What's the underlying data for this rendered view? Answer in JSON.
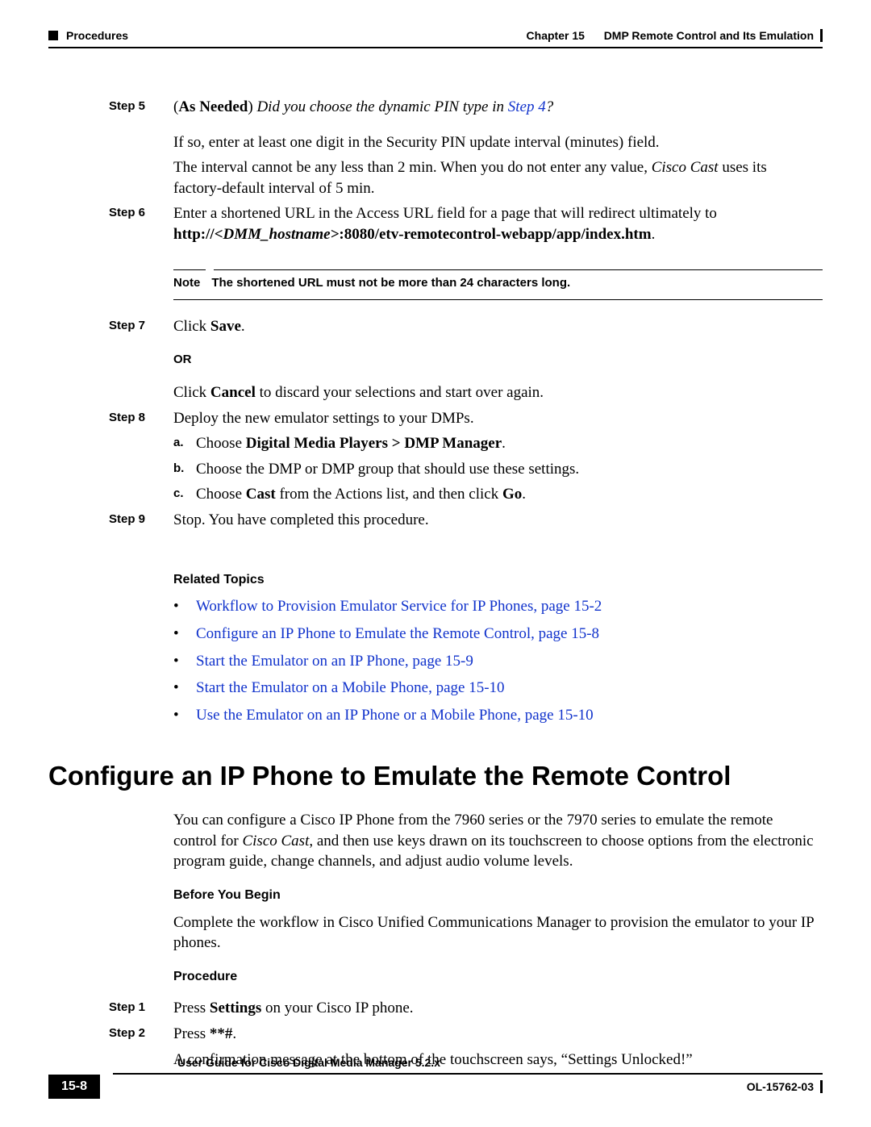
{
  "header": {
    "section": "Procedures",
    "chapter_label": "Chapter 15",
    "chapter_title": "DMP Remote Control and Its Emulation"
  },
  "steps": {
    "s5_label": "Step 5",
    "s5_prefix": "(",
    "s5_bold": "As Needed",
    "s5_suffix": ")",
    "s5_italic": " Did you choose the dynamic PIN type in ",
    "s5_link": "Step 4",
    "s5_qmark": "?",
    "s5_p1": "If so, enter at least one digit in the Security PIN update interval (minutes) field.",
    "s5_p2a": "The interval cannot be any less than 2 min. When you do not enter any value, ",
    "s5_p2i": "Cisco Cast",
    "s5_p2b": " uses its factory-default interval of 5 min.",
    "s6_label": "Step 6",
    "s6_a": "Enter a shortened URL in the Access URL field for a page that will redirect ultimately to ",
    "s6_b1": "http://",
    "s6_bi": "<DMM_hostname>",
    "s6_b2": ":8080/etv-remotecontrol-webapp/app/index.htm",
    "s6_dot": ".",
    "note_label": "Note",
    "note_text": "The shortened URL must not be more than 24 characters long.",
    "s7_label": "Step 7",
    "s7_a": "Click ",
    "s7_b": "Save",
    "s7_c": ".",
    "or": "OR",
    "s7_p2a": "Click ",
    "s7_p2b": "Cancel",
    "s7_p2c": " to discard your selections and start over again.",
    "s8_label": "Step 8",
    "s8_a": "Deploy the new emulator settings to your DMPs.",
    "s8_sub_a_m": "a.",
    "s8_sub_a_1": "Choose ",
    "s8_sub_a_2": "Digital Media Players > DMP Manager",
    "s8_sub_a_3": ".",
    "s8_sub_b_m": "b.",
    "s8_sub_b": "Choose the DMP or DMP group that should use these settings.",
    "s8_sub_c_m": "c.",
    "s8_sub_c_1": "Choose ",
    "s8_sub_c_2": "Cast",
    "s8_sub_c_3": " from the Actions list, and then click ",
    "s8_sub_c_4": "Go",
    "s8_sub_c_5": ".",
    "s9_label": "Step 9",
    "s9_a": "Stop. You have completed this procedure."
  },
  "related": {
    "heading": "Related Topics",
    "b1": "Workflow to Provision Emulator Service for IP Phones, page 15-2",
    "b2": "Configure an IP Phone to Emulate the Remote Control, page 15-8",
    "b3": "Start the Emulator on an IP Phone, page 15-9",
    "b4": "Start the Emulator on a Mobile Phone, page 15-10",
    "b5": "Use the Emulator on an IP Phone or a Mobile Phone, page 15-10"
  },
  "section2": {
    "title": "Configure an IP Phone to Emulate the Remote Control",
    "p1a": "You can configure a Cisco IP Phone from the 7960 series or the 7970 series to emulate the remote control for ",
    "p1i": "Cisco Cast",
    "p1b": ", and then use keys drawn on its touchscreen to choose options from the electronic program guide, change channels, and adjust audio volume levels.",
    "byb": "Before You Begin",
    "p2": "Complete the workflow in Cisco Unified Communications Manager to provision the emulator to your IP phones.",
    "proc": "Procedure",
    "s1_label": "Step 1",
    "s1_a": "Press ",
    "s1_b": "Settings",
    "s1_c": " on your Cisco IP phone.",
    "s2_label": "Step 2",
    "s2_a": "Press ",
    "s2_b": "**#",
    "s2_c": ".",
    "s2_p2": "A confirmation message at the bottom of the touchscreen says, “Settings Unlocked!”"
  },
  "footer": {
    "guide": "User Guide for Cisco Digital Media Manager 5.2.x",
    "page": "15-8",
    "doc": "OL-15762-03"
  }
}
